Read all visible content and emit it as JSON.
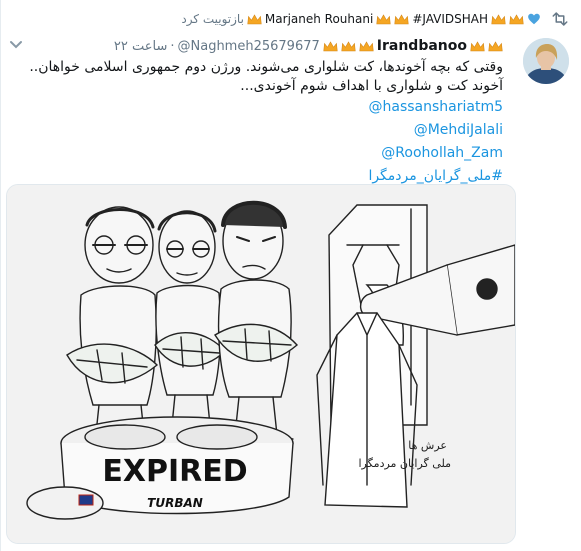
{
  "context": {
    "action": "بازتوییت کرد",
    "retweeter_name": "Marjaneh Rouhani",
    "hashtag": "#JAVIDSHAH"
  },
  "tweet": {
    "display_name": "Irandbanoo",
    "handle": "@Naghmeh25679677",
    "separator": "·",
    "timestamp": "۲۲ ساعت",
    "text_lines": [
      "وقتی که بچه آخوندها، کت شلواری می‌شوند. ورژن دوم جمهوری اسلامی خواهان..",
      "آخوند کت و شلواری با اهداف شوم آخوندی..."
    ],
    "mentions": [
      "@hassanshariatm5",
      "@MehdiJalali",
      "@Roohollah_Zam"
    ],
    "hashtag": "#ملی_گرایان_مردمگرا"
  },
  "media": {
    "tin_label": "EXPIRED",
    "tin_sublabel": "TURBAN",
    "signature": "عرش ها",
    "signature_sub": "ملی گرایان مردمگرا"
  },
  "colors": {
    "link": "#1b95e0",
    "muted": "#657786",
    "heart": "#4aa3df",
    "crown": "#f5a623",
    "retweet": "#657786"
  },
  "icons": [
    "retweet-icon",
    "heart-icon",
    "crown-icon",
    "chevron-down-icon"
  ]
}
